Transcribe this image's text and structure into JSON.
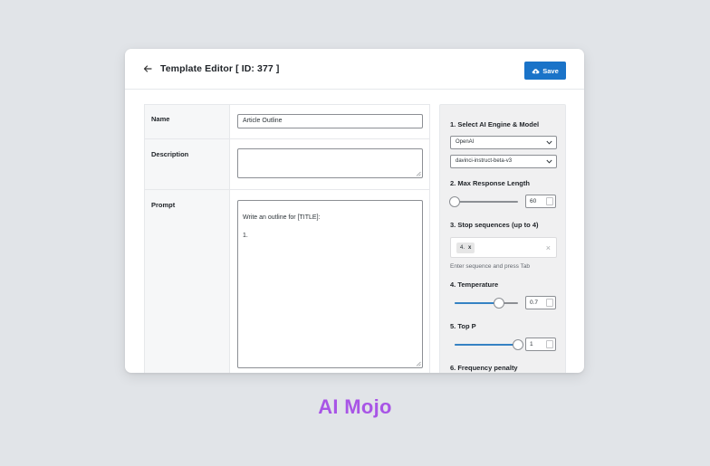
{
  "header": {
    "title": "Template Editor [ ID: 377 ]",
    "save_label": "Save"
  },
  "form": {
    "name_label": "Name",
    "name_value": "Article Outline",
    "description_label": "Description",
    "description_value": "",
    "prompt_label": "Prompt",
    "prompt_value": "Write an outline for [TITLE]:\n\n1."
  },
  "sidebar": {
    "engine": {
      "title": "1. Select AI Engine & Model",
      "provider": "OpenAI",
      "model": "davinci-instruct-beta-v3"
    },
    "max_length": {
      "title": "2. Max Response Length",
      "value": "60",
      "level": 0.0
    },
    "stop_sequences": {
      "title": "3. Stop sequences (up to 4)",
      "tags": [
        "4."
      ],
      "tag_remove": "x",
      "clear": "×",
      "hint": "Enter sequence and press Tab"
    },
    "temperature": {
      "title": "4. Temperature",
      "value": "0.7",
      "level": 0.7
    },
    "top_p": {
      "title": "5. Top P",
      "value": "1",
      "level": 1.0
    },
    "frequency_penalty": {
      "title": "6. Frequency penalty"
    }
  },
  "brand": {
    "name": "AI Mojo",
    "color": "#a855e6"
  },
  "colors": {
    "accent": "#1a73c8",
    "slider_fill": "#3582c4"
  },
  "icons": {
    "back": "arrow-left-icon",
    "save": "cloud-upload-icon",
    "dropdown": "chevron-down-icon"
  }
}
